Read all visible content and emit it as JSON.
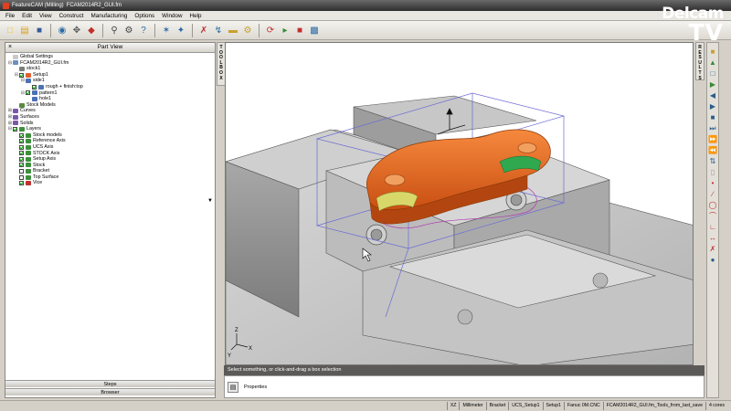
{
  "window": {
    "title_left": "FeatureCAM (Milling)",
    "title_right": "FCAM2014R2_GUI.fm"
  },
  "logo": {
    "line1": "Delcam",
    "line2": "TV"
  },
  "menu": [
    "File",
    "Edit",
    "View",
    "Construct",
    "Manufacturing",
    "Options",
    "Window",
    "Help"
  ],
  "toolbar_icons": [
    "new-icon",
    "open-icon",
    "save-icon",
    "print-icon",
    "globe-icon",
    "pan-icon",
    "eraser-icon",
    "zoom-icon",
    "settings-icon",
    "help-icon",
    "star-icon",
    "snap-icon",
    "curve-icon",
    "chain-icon",
    "measure-icon",
    "simulate-icon",
    "tool-icon",
    "stock-icon"
  ],
  "left_panel": {
    "title": "Part View",
    "tree": [
      {
        "indent": 0,
        "exp": "",
        "check": false,
        "icon": "#c9c9c9",
        "label": "Global Settings"
      },
      {
        "indent": 0,
        "exp": "-",
        "check": false,
        "icon": "#6e8fc0",
        "label": "FCAM2014R2_GUI.fm"
      },
      {
        "indent": 1,
        "exp": "",
        "check": false,
        "icon": "#7e7e7e",
        "label": "stock1"
      },
      {
        "indent": 1,
        "exp": "-",
        "check": true,
        "icon": "#e06030",
        "label": "Setup1"
      },
      {
        "indent": 2,
        "exp": "-",
        "check": false,
        "icon": "#4b72b5",
        "label": "side1"
      },
      {
        "indent": 3,
        "exp": "",
        "check": true,
        "icon": "#4b72b5",
        "label": "rough + finish:top"
      },
      {
        "indent": 2,
        "exp": "-",
        "check": true,
        "icon": "#4b72b5",
        "label": "pattern1"
      },
      {
        "indent": 3,
        "exp": "",
        "check": false,
        "icon": "#4b72b5",
        "label": "hole1"
      },
      {
        "indent": 1,
        "exp": "",
        "check": false,
        "icon": "#5a8a40",
        "label": "Stock Models"
      },
      {
        "indent": 0,
        "exp": "+",
        "check": false,
        "icon": "#7a5aa8",
        "label": "Curves"
      },
      {
        "indent": 0,
        "exp": "+",
        "check": false,
        "icon": "#7a5aa8",
        "label": "Surfaces"
      },
      {
        "indent": 0,
        "exp": "+",
        "check": false,
        "icon": "#7a5aa8",
        "label": "Solids"
      },
      {
        "indent": 0,
        "exp": "-",
        "check": true,
        "icon": "#3d8f3d",
        "label": "Layers"
      },
      {
        "indent": 1,
        "exp": "",
        "check": true,
        "icon": "#3d8f3d",
        "label": "Stock models"
      },
      {
        "indent": 1,
        "exp": "",
        "check": true,
        "icon": "#3d8f3d",
        "label": "Reference Axis"
      },
      {
        "indent": 1,
        "exp": "",
        "check": true,
        "icon": "#3d8f3d",
        "label": "UCS Axis"
      },
      {
        "indent": 1,
        "exp": "",
        "check": true,
        "icon": "#3d8f3d",
        "label": "STOCK Axis"
      },
      {
        "indent": 1,
        "exp": "",
        "check": true,
        "icon": "#3d8f3d",
        "label": "Setup Axis"
      },
      {
        "indent": 1,
        "exp": "",
        "check": true,
        "icon": "#3d8f3d",
        "label": "Stock"
      },
      {
        "indent": 1,
        "exp": "",
        "check": false,
        "icon": "#3d8f3d",
        "label": "Bracket"
      },
      {
        "indent": 1,
        "exp": "",
        "check": false,
        "icon": "#3d8f3d",
        "label": "Top Surface"
      },
      {
        "indent": 1,
        "exp": "",
        "check": true,
        "icon": "#c03030",
        "label": "Vice"
      }
    ],
    "bottom_tabs": [
      "Steps",
      "Browser"
    ]
  },
  "toolbox_label": "TOOLBOX",
  "results_label": "RESULTS",
  "status_message": "Select something, or click-and-drag a box selection",
  "console_text": "Properties",
  "axes": {
    "z": "Z",
    "y": "Y",
    "x": "X"
  },
  "status_bar": [
    "XZ",
    "Millimeter",
    "Bracket",
    "UCS_Setup1",
    "Setup1",
    "Fanuc 0M.CNC",
    "FCAM2014R2_GUI.fm_Tools_from_last_save",
    "4 cores"
  ],
  "colors": {
    "part_orange": "#e8641e",
    "part_green": "#2fa84f",
    "part_yellow": "#d8d86a",
    "vice_grey": "#bdbdbd"
  }
}
